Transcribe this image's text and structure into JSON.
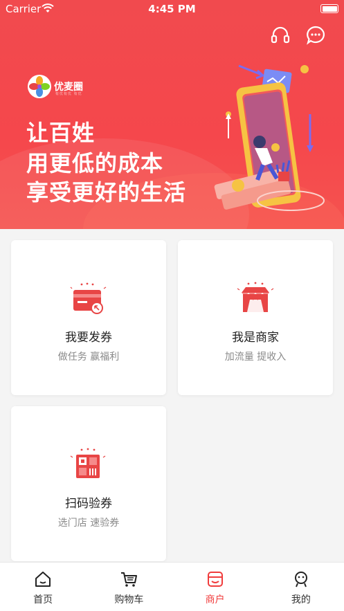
{
  "status_bar": {
    "carrier": "Carrier",
    "time": "4:45 PM"
  },
  "hero": {
    "logo_name": "优麦圈",
    "logo_sub": "有优有优 有优",
    "slogan_lines": [
      "让百姓",
      "用更低的成本",
      "享受更好的生活"
    ]
  },
  "top_actions": {
    "support_icon": "headset-icon",
    "chat_icon": "chat-bubble-icon"
  },
  "cards": [
    {
      "title": "我要发券",
      "subtitle": "做任务 赢福利",
      "icon": "coupon-issue-icon"
    },
    {
      "title": "我是商家",
      "subtitle": "加流量 提收入",
      "icon": "merchant-shop-icon"
    },
    {
      "title": "扫码验券",
      "subtitle": "选门店 速验券",
      "icon": "scan-verify-icon"
    }
  ],
  "tabs": [
    {
      "label": "首页",
      "icon": "home-icon",
      "active": false
    },
    {
      "label": "购物车",
      "icon": "cart-icon",
      "active": false
    },
    {
      "label": "商户",
      "icon": "store-icon",
      "active": true
    },
    {
      "label": "我的",
      "icon": "profile-icon",
      "active": false
    }
  ],
  "colors": {
    "brand": "#f5474c",
    "active_tab": "#f03c3c",
    "card_icon": "#e84545"
  }
}
